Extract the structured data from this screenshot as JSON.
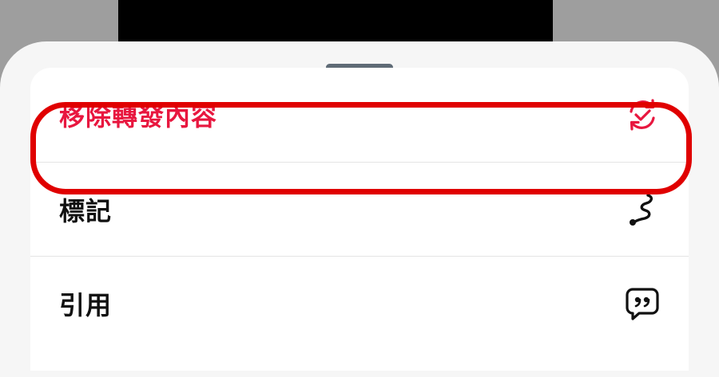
{
  "menu": {
    "items": [
      {
        "label": "移除轉發內容",
        "icon": "repost-remove-icon",
        "color": "#e8173f"
      },
      {
        "label": "標記",
        "icon": "squiggle-mark-icon",
        "color": "#111111"
      },
      {
        "label": "引用",
        "icon": "quote-bubble-icon",
        "color": "#111111"
      }
    ]
  },
  "colors": {
    "highlight": "#e00000",
    "destructive": "#e8173f",
    "sheet_background": "#f6f6f6"
  }
}
